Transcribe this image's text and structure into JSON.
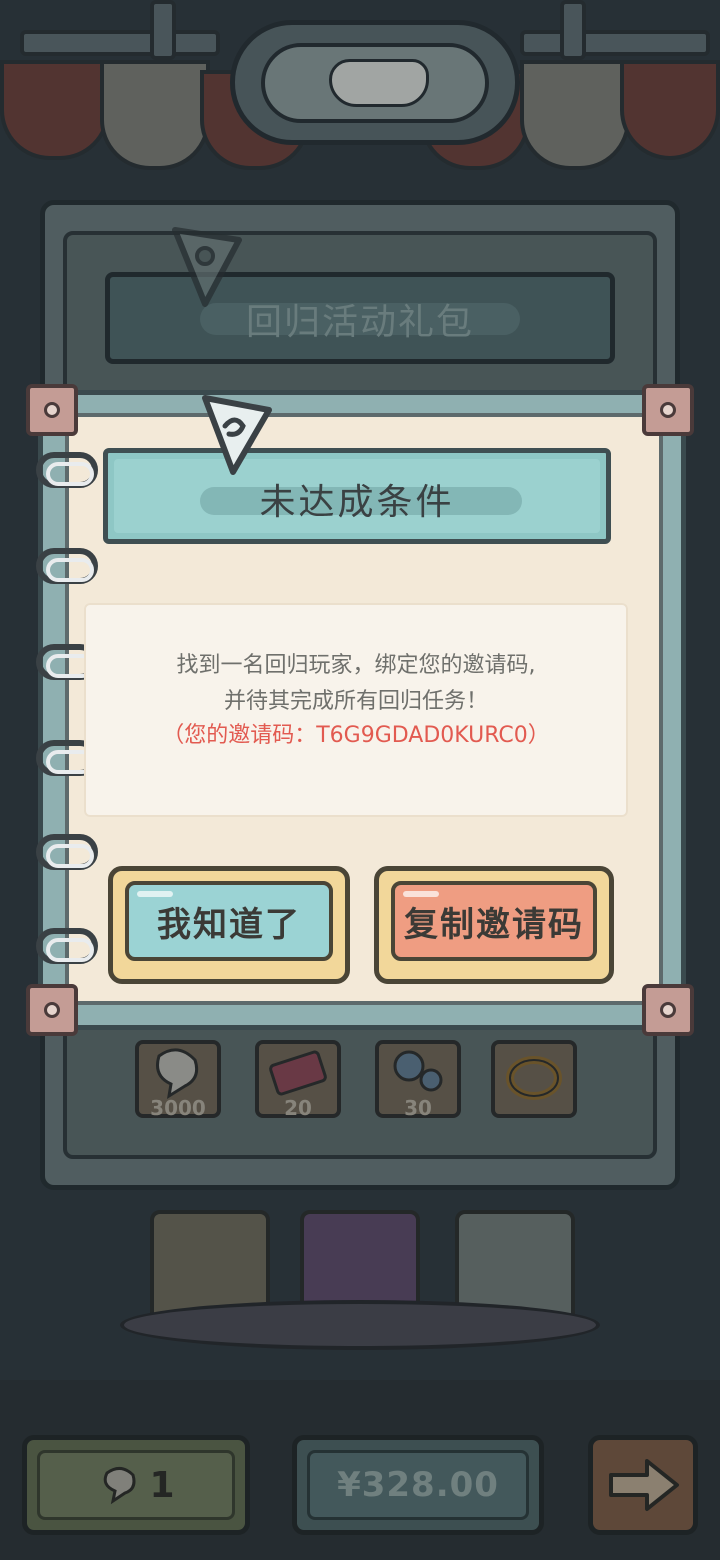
{
  "background": {
    "panel_title": "回归活动礼包",
    "rewards": [
      {
        "icon": "ghost-icon",
        "count": "3000"
      },
      {
        "icon": "ticket-icon",
        "count": "20"
      },
      {
        "icon": "potion-icon",
        "count": "30"
      },
      {
        "icon": "ring-icon",
        "count": ""
      }
    ],
    "ticket_count": "1",
    "price": "¥328.00"
  },
  "dialog": {
    "title": "未达成条件",
    "message_line1": "找到一名回归玩家，绑定您的邀请码,",
    "message_line2": "并待其完成所有回归任务！",
    "invite_line": "（您的邀请码：T6G9GDAD0KURC0）",
    "ok_label": "我知道了",
    "copy_label": "复制邀请码"
  },
  "colors": {
    "accent_teal": "#9bd3d4",
    "accent_salmon": "#ef9d82",
    "invite_code_red": "#e25a50",
    "paper": "#f3e9d8"
  }
}
